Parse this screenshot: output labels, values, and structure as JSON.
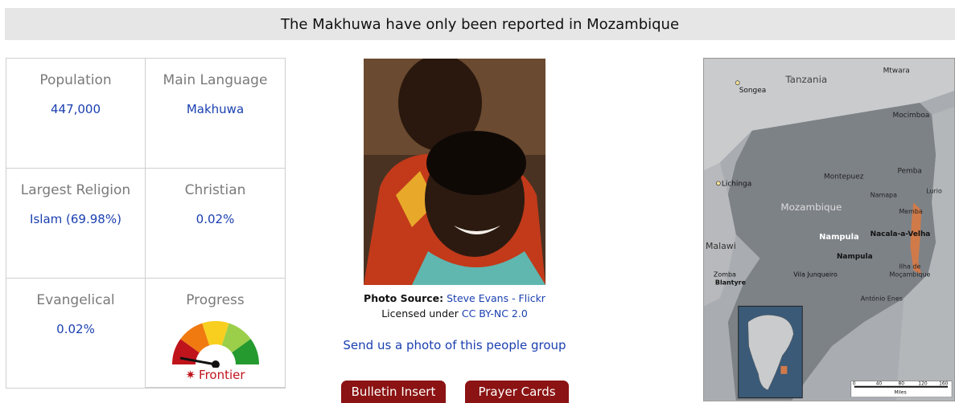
{
  "banner": {
    "title": "The Makhuwa have only been reported in Mozambique"
  },
  "stats": {
    "population_label": "Population",
    "population_value": "447,000",
    "language_label": "Main Language",
    "language_value": "Makhuwa",
    "religion_label": "Largest Religion",
    "religion_value": "Islam (69.98%)",
    "christian_label": "Christian",
    "christian_value": "0.02%",
    "evangelical_label": "Evangelical",
    "evangelical_value": "0.02%",
    "progress_label": "Progress",
    "progress_status": "Frontier",
    "progress_star": "✷"
  },
  "photo": {
    "source_label": "Photo Source:",
    "source_link": "Steve Evans - Flickr",
    "license_text": "Licensed under",
    "license_link": "CC BY-NC 2.0",
    "send_link": "Send us a photo of this people group"
  },
  "buttons": {
    "bulletin": "Bulletin Insert",
    "prayer": "Prayer Cards"
  },
  "map": {
    "labels": {
      "mtwara": "Mtwara",
      "tanzania": "Tanzania",
      "songea": "Songea",
      "mocimboa": "Mocimboa",
      "pemba": "Pemba",
      "lichinga": "Lichinga",
      "montepuez": "Montepuez",
      "lurio": "Lurio",
      "namapa": "Namapa",
      "mozambique": "Mozambique",
      "memba": "Memba",
      "nacala": "Nacala-a-Velha",
      "nampula_region": "Nampula",
      "nampula_city": "Nampula",
      "malawi": "Malawi",
      "zomba": "Zomba",
      "blantyre": "Blantyre",
      "vila": "Vila Junqueiro",
      "ilha1": "Ilha de",
      "ilha2": "Moçambique",
      "antonio": "António Enes",
      "scale_0": "0",
      "scale_40": "40",
      "scale_80": "80",
      "scale_120": "120",
      "scale_160": "160",
      "scale_unit": "Miles"
    }
  }
}
